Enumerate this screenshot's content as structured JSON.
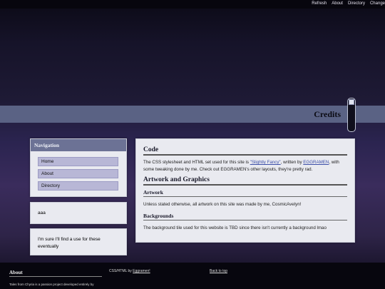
{
  "topnav": {
    "items": [
      "Refresh",
      "About",
      "Directory",
      "Change"
    ]
  },
  "banner": {
    "title": "Credits"
  },
  "navigation": {
    "title": "Navigation",
    "items": [
      "Home",
      "About",
      "Directory"
    ]
  },
  "side_boxes": {
    "box1": "aaa",
    "box2": "I'm sure I'll find a use for these eventually"
  },
  "main": {
    "code_heading": "Code",
    "code_text_1": "The CSS stylesheet and HTML set used for this site is ",
    "code_link_1": "\"Slightly Fancy\"",
    "code_text_2": ", written by ",
    "code_link_2": "EGGRAMEN",
    "code_text_3": ", with some tweaking done by me. Check out EGGRAMEN's other layouts, they're pretty rad.",
    "art_heading": "Artwork and Graphics",
    "artwork_subheading": "Artwork",
    "artwork_text": "Unless stated otherwise, all artwork on this site was made by me, CosmicAvelyn!",
    "backgrounds_subheading": "Backgrounds",
    "backgrounds_text": "The background tile used for this website is TBD since there isn't currently a background lmao"
  },
  "footer": {
    "about_title": "About",
    "about_text": "Tales from Chyria is a passion project developed entirely by",
    "credit_prefix": "CSS/HTML by ",
    "credit_link": "Eggramen!",
    "back_to_top": "Back to top"
  }
}
